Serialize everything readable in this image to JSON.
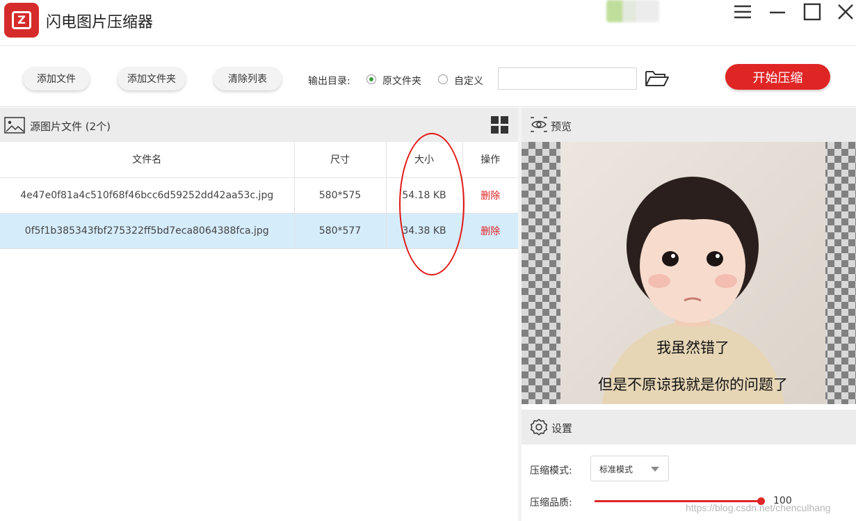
{
  "app": {
    "title": "闪电图片压缩器"
  },
  "toolbar": {
    "add_file": "添加文件",
    "add_folder": "添加文件夹",
    "clear_list": "清除列表",
    "output_label": "输出目录:",
    "output_options": [
      {
        "label": "原文件夹",
        "selected": true
      },
      {
        "label": "自定义",
        "selected": false
      }
    ],
    "path_value": "",
    "start": "开始压缩"
  },
  "source": {
    "title": "源图片文件 (2个)",
    "columns": [
      "文件名",
      "尺寸",
      "大小",
      "操作"
    ],
    "rows": [
      {
        "name": "4e47e0f81a4c510f68f46bcc6d59252dd42aa53c.jpg",
        "dim": "580*575",
        "size": "54.18 KB",
        "action": "删除",
        "selected": false
      },
      {
        "name": "0f5f1b385343fbf275322ff5bd7eca8064388fca.jpg",
        "dim": "580*577",
        "size": "34.38 KB",
        "action": "删除",
        "selected": true
      }
    ]
  },
  "preview": {
    "title": "预览",
    "caption1": "我虽然错了",
    "caption2": "但是不原谅我就是你的问题了"
  },
  "settings": {
    "title": "设置",
    "mode_label": "压缩模式:",
    "mode_value": "标准模式",
    "quality_label": "压缩品质:",
    "quality_value": "100",
    "quality_fraction": 1.0
  },
  "watermark": "https://blog.csdn.net/chenculhang",
  "colors": {
    "accent": "#e02525",
    "selected_row": "#d5ecfa",
    "header_bg": "#ececec"
  },
  "icons": {
    "logo": "app-logo-icon",
    "menu": "hamburger-menu-icon",
    "minimize": "minimize-icon",
    "maximize": "maximize-icon",
    "close": "close-icon",
    "folder": "folder-open-icon",
    "image": "image-icon",
    "grid": "grid-view-icon",
    "eye": "eye-icon",
    "gear": "gear-icon"
  }
}
